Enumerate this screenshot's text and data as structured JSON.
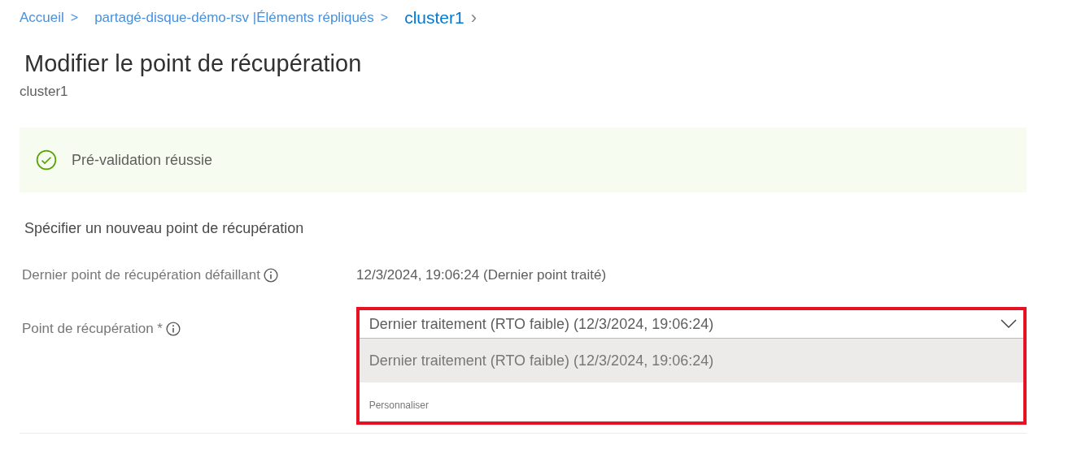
{
  "breadcrumb": [
    {
      "label": "Accueil",
      "separator": ">",
      "current": false
    },
    {
      "label": "partagé-disque-démo-rsv |Éléments répliqués",
      "separator": ">",
      "current": false
    },
    {
      "label": "cluster1",
      "separator": "›",
      "current": true
    }
  ],
  "title": "Modifier le point de récupération",
  "subtitle": "cluster1",
  "banner": {
    "text": "Pré-validation réussie"
  },
  "section_heading": "Spécifier un nouveau point de récupération",
  "fields": [
    {
      "kind": "text",
      "label": "Dernier point de récupération défaillant",
      "value": "12/3/2024, 19:06:24 (Dernier point traité)"
    },
    {
      "kind": "dropdown",
      "label": "Point de récupération *",
      "value": "Dernier traitement (RTO faible) (12/3/2024, 19:06:24)",
      "expanded": true,
      "options": [
        {
          "label": "Dernier traitement (RTO faible) (12/3/2024, 19:06:24)",
          "selected": true
        },
        {
          "label": "Personnaliser",
          "selected": false
        }
      ]
    }
  ]
}
